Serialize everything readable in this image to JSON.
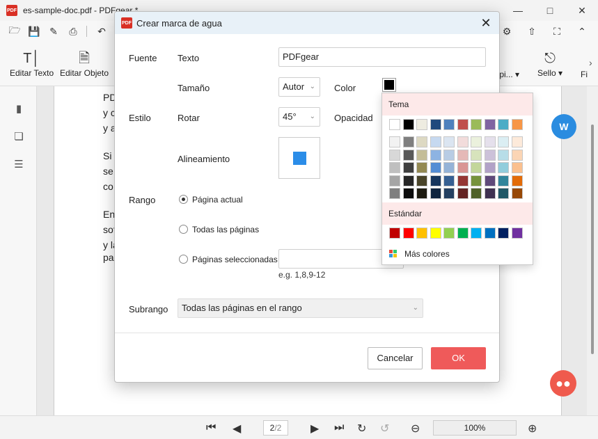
{
  "app": {
    "title": "es-sample-doc.pdf - PDFgear *",
    "logo_text": "PDF"
  },
  "ribbon": {
    "edit_text": "Editar Texto",
    "edit_object": "Editar Objeto",
    "right_partial": "y pi...",
    "stamp": "Sello",
    "more_partial": "Fi"
  },
  "document": {
    "lines": [
      {
        "text": "PD"
      },
      {
        "text": "y c"
      },
      {
        "text": "y a"
      },
      {
        "text": "Si l"
      },
      {
        "text": "se "
      },
      {
        "text": "co"
      },
      {
        "text": "En"
      },
      {
        "text": "sof"
      },
      {
        "text": "y la"
      },
      {
        "text": "pa"
      }
    ]
  },
  "bottombar": {
    "page_current": "2",
    "page_total": "/2",
    "zoom": "100%"
  },
  "dialog": {
    "title": "Crear marca de agua",
    "source_label": "Fuente",
    "text_label": "Texto",
    "text_value": "PDFgear",
    "size_label": "Tamaño",
    "size_value": "Autor",
    "color_label": "Color",
    "style_label": "Estilo",
    "rotate_label": "Rotar",
    "rotate_value": "45°",
    "opacity_label": "Opacidad",
    "alignment_label": "Alineamiento",
    "range_label": "Rango",
    "range_current": "Página actual",
    "range_all": "Todas las páginas",
    "range_selected": "Páginas seleccionadas",
    "range_hint": "e.g. 1,8,9-12",
    "subrange_label": "Subrango",
    "subrange_value": "Todas las páginas en el rango",
    "cancel": "Cancelar",
    "ok": "OK",
    "current_color": "#000000"
  },
  "color_popup": {
    "theme_label": "Tema",
    "standard_label": "Estándar",
    "more_colors": "Más colores",
    "theme_top": [
      "#ffffff",
      "#000000",
      "#eeece1",
      "#1f497d",
      "#4f81bd",
      "#c0504d",
      "#9bbb59",
      "#8064a2",
      "#4bacc6",
      "#f79646"
    ],
    "theme_shades": [
      [
        "#f2f2f2",
        "#7f7f7f",
        "#ddd9c3",
        "#c6d9f0",
        "#dbe5f1",
        "#f2dcdb",
        "#ebf1dd",
        "#e5e0ec",
        "#dbeef3",
        "#fdeada"
      ],
      [
        "#d8d8d8",
        "#595959",
        "#c4bd97",
        "#8db3e2",
        "#b8cce4",
        "#e5b9b7",
        "#d7e3bc",
        "#ccc1d9",
        "#b7dde8",
        "#fbd5b5"
      ],
      [
        "#bfbfbf",
        "#3f3f3f",
        "#938953",
        "#548dd4",
        "#95b3d7",
        "#d99694",
        "#c3d69b",
        "#b2a2c7",
        "#92cddc",
        "#fac08f"
      ],
      [
        "#a5a5a5",
        "#262626",
        "#494429",
        "#17365d",
        "#366092",
        "#953734",
        "#76923c",
        "#5f497a",
        "#31859b",
        "#e36c09"
      ],
      [
        "#7f7f7f",
        "#0c0c0c",
        "#1d1b10",
        "#0f243e",
        "#244061",
        "#632423",
        "#4f6128",
        "#3f3151",
        "#205867",
        "#974806"
      ]
    ],
    "standard": [
      "#c00000",
      "#ff0000",
      "#ffc000",
      "#ffff00",
      "#92d050",
      "#00b050",
      "#00b0f0",
      "#0070c0",
      "#002060",
      "#7030a0"
    ]
  }
}
